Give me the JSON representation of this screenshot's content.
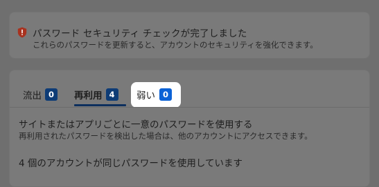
{
  "status": {
    "title": "パスワード セキュリティ チェックが完了しました",
    "description": "これらのパスワードを更新すると、アカウントのセキュリティを強化できます。",
    "icon": "warning-shield-icon"
  },
  "tabs": [
    {
      "label": "流出",
      "count": "0"
    },
    {
      "label": "再利用",
      "count": "4"
    },
    {
      "label": "弱い",
      "count": "0"
    }
  ],
  "section": {
    "title": "サイトまたはアプリごとに一意のパスワードを使用する",
    "description": "再利用されたパスワードを検出した場合は、他のアカウントにアクセスできます。",
    "count_text": "4 個のアカウントが同じパスワードを使用しています"
  },
  "colors": {
    "badge": "#0e3c76",
    "badge_active": "#0b62d6",
    "shield": "#a8321f",
    "highlight": "#ffffff"
  }
}
